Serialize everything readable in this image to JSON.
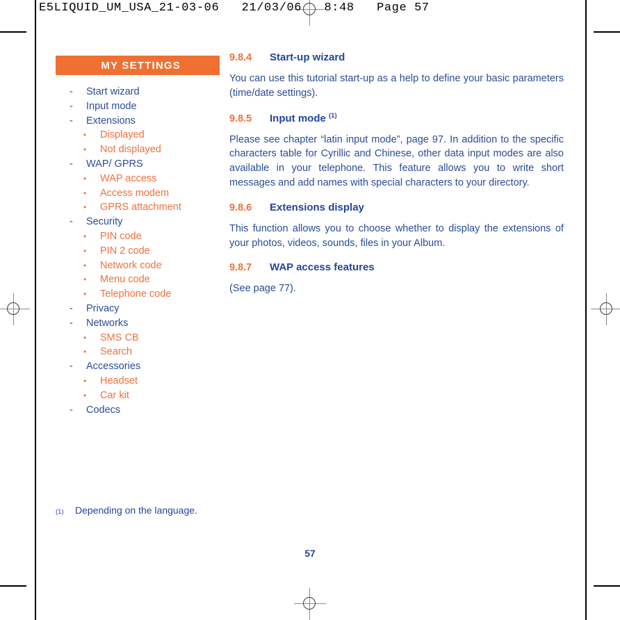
{
  "print_marks": {
    "imposition_text": "E5LIQUID_UM_USA_21-03-06   21/03/06   8:48   Page 57"
  },
  "colors": {
    "orange": "#F07032",
    "orange_text": "#F0703C",
    "blue_heading": "#23469B",
    "blue_body": "#2B4C96",
    "white": "#FFFFFF"
  },
  "sidebar": {
    "title": "MY SETTINGS",
    "items": [
      {
        "level": 1,
        "bullet": "-",
        "label": "Start wizard"
      },
      {
        "level": 1,
        "bullet": "-",
        "label": "Input mode"
      },
      {
        "level": 1,
        "bullet": "-",
        "label": "Extensions"
      },
      {
        "level": 2,
        "bullet": "•",
        "label": "Displayed"
      },
      {
        "level": 2,
        "bullet": "•",
        "label": "Not displayed"
      },
      {
        "level": 1,
        "bullet": "-",
        "label": "WAP/ GPRS"
      },
      {
        "level": 2,
        "bullet": "•",
        "label": "WAP access"
      },
      {
        "level": 2,
        "bullet": "•",
        "label": "Access modem"
      },
      {
        "level": 2,
        "bullet": "•",
        "label": "GPRS attachment"
      },
      {
        "level": 1,
        "bullet": "-",
        "label": "Security"
      },
      {
        "level": 2,
        "bullet": "•",
        "label": "PIN code"
      },
      {
        "level": 2,
        "bullet": "•",
        "label": "PIN 2 code"
      },
      {
        "level": 2,
        "bullet": "•",
        "label": "Network code"
      },
      {
        "level": 2,
        "bullet": "•",
        "label": "Menu code"
      },
      {
        "level": 2,
        "bullet": "•",
        "label": "Telephone code"
      },
      {
        "level": 1,
        "bullet": "-",
        "label": "Privacy"
      },
      {
        "level": 1,
        "bullet": "-",
        "label": "Networks"
      },
      {
        "level": 2,
        "bullet": "•",
        "label": "SMS CB"
      },
      {
        "level": 2,
        "bullet": "•",
        "label": "Search"
      },
      {
        "level": 1,
        "bullet": "-",
        "label": "Accessories"
      },
      {
        "level": 2,
        "bullet": "•",
        "label": "Headset"
      },
      {
        "level": 2,
        "bullet": "•",
        "label": "Car kit"
      },
      {
        "level": 1,
        "bullet": "-",
        "label": "Codecs"
      }
    ]
  },
  "main": {
    "sections": [
      {
        "number": "9.8.4",
        "title": "Start-up wizard",
        "superscript": "",
        "body": "You can use this tutorial start-up as a help to define your basic parameters (time/date settings)."
      },
      {
        "number": "9.8.5",
        "title": "Input mode",
        "superscript": "(1)",
        "body": "Please see chapter “latin input mode”, page 97. In addition to the specific characters table for Cyrillic and Chinese, other data input modes are also available in your telephone. This feature allows you to write short messages and add names with special characters to your directory."
      },
      {
        "number": "9.8.6",
        "title": "Extensions display",
        "superscript": "",
        "body": "This function allows you to choose whether to display the extensions of your photos, videos, sounds, files in your Album."
      },
      {
        "number": "9.8.7",
        "title": "WAP access features",
        "superscript": "",
        "body": "(See page 77)."
      }
    ]
  },
  "footnote": {
    "marker": "(1)",
    "text": "Depending on the language."
  },
  "page_number": "57"
}
